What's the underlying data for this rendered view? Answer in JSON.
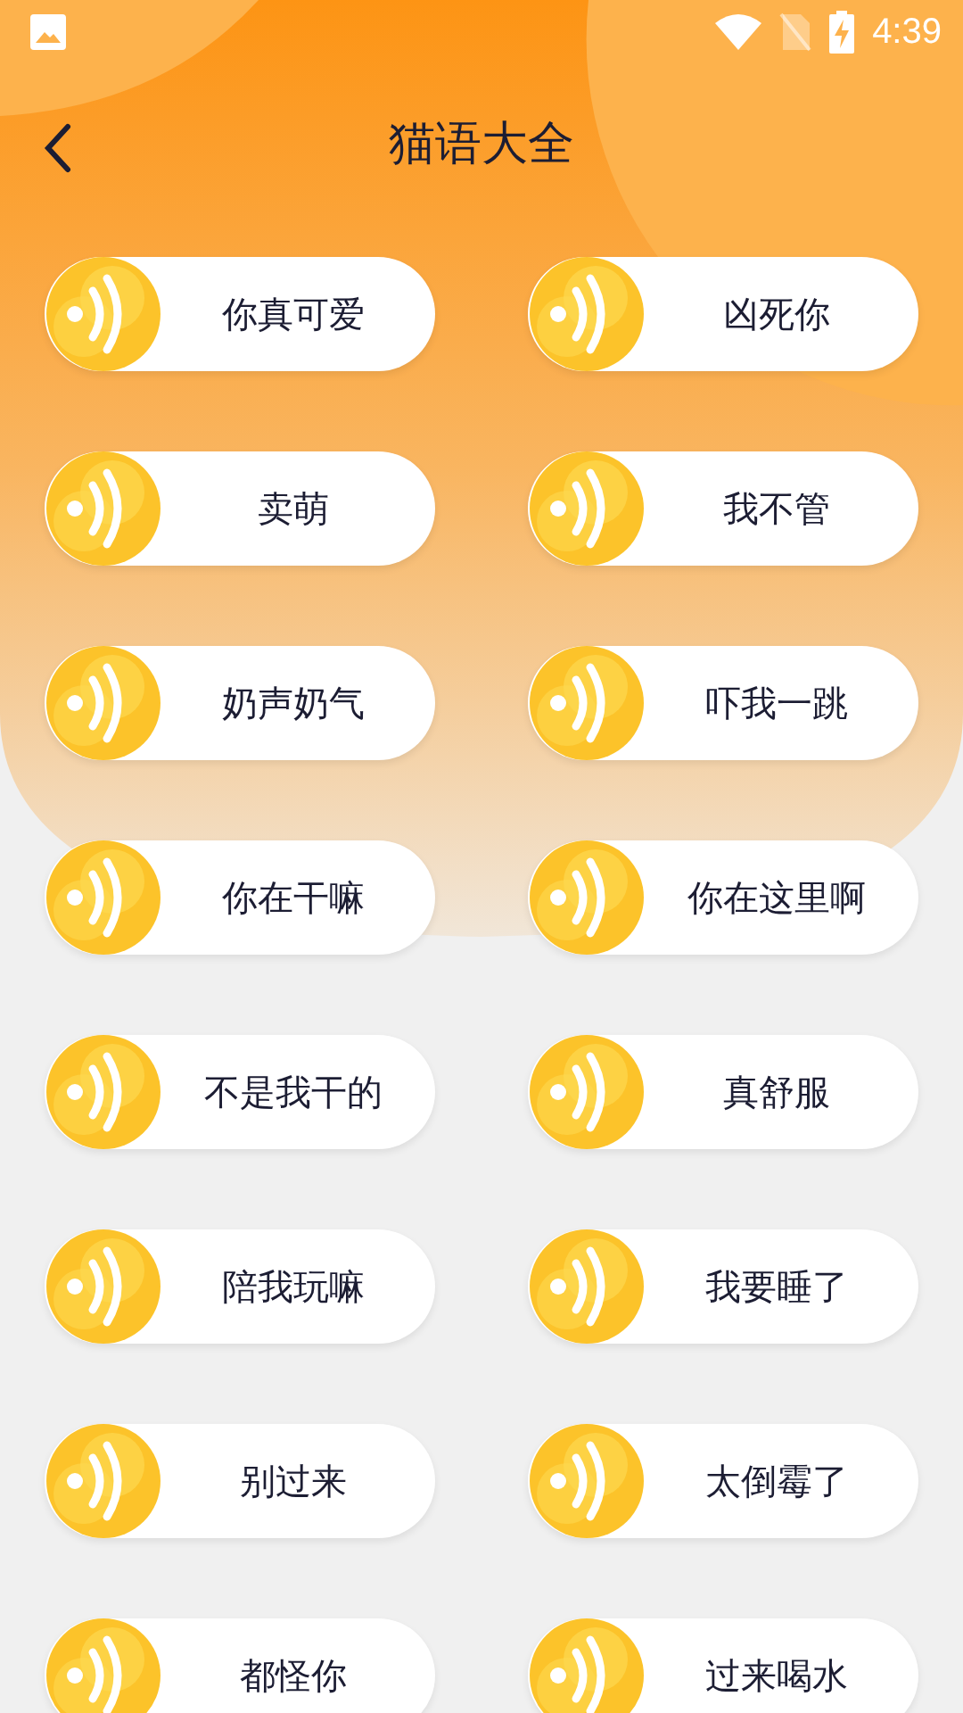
{
  "status_bar": {
    "time": "4:39"
  },
  "header": {
    "title": "猫语大全"
  },
  "phrases": [
    "你真可爱",
    "凶死你",
    "卖萌",
    "我不管",
    "奶声奶气",
    "吓我一跳",
    "你在干嘛",
    "你在这里啊",
    "不是我干的",
    "真舒服",
    "陪我玩嘛",
    "我要睡了",
    "别过来",
    "太倒霉了",
    "都怪你",
    "过来喝水"
  ]
}
